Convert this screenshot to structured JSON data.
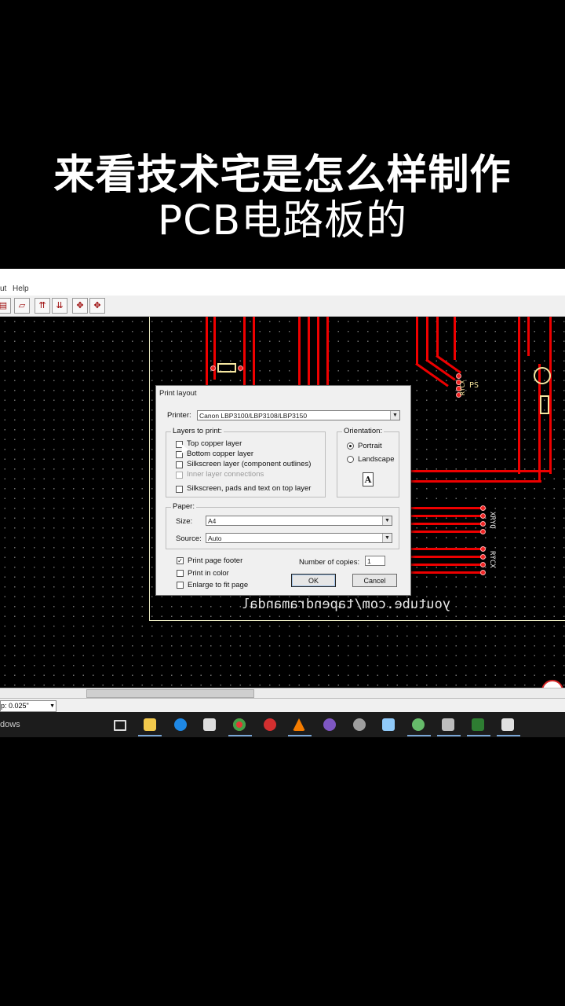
{
  "caption": {
    "line1": "来看技术宅是怎么样制作",
    "line2": "PCB电路板的"
  },
  "menubar": {
    "items": [
      "ut",
      "Help"
    ]
  },
  "canvas": {
    "labels": {
      "ps": "PS",
      "rycx_top": "RYCX",
      "xryq": "XRYQ",
      "rycx_bottom": "RYCX",
      "watermark": "youtube.com/tapendramandal"
    }
  },
  "status": {
    "grid": "p: 0.025\""
  },
  "taskbar": {
    "start_text": "dows"
  },
  "dialog": {
    "title": "Print layout",
    "printer_label": "Printer:",
    "printer_value": "Canon LBP3100/LBP3108/LBP3150",
    "layers_label": "Layers to print:",
    "layers": [
      {
        "label": "Top copper layer",
        "checked": false,
        "enabled": true
      },
      {
        "label": "Bottom copper layer",
        "checked": false,
        "enabled": true
      },
      {
        "label": "Silkscreen layer (component outlines)",
        "checked": false,
        "enabled": true
      },
      {
        "label": "Inner layer connections",
        "checked": false,
        "enabled": false
      },
      {
        "label": "Silkscreen, pads and text on top layer",
        "checked": false,
        "enabled": true
      }
    ],
    "orientation_label": "Orientation:",
    "portrait_label": "Portrait",
    "landscape_label": "Landscape",
    "orientation_selected": "Portrait",
    "orientation_icon_letter": "A",
    "paper_label": "Paper:",
    "size_label": "Size:",
    "size_value": "A4",
    "source_label": "Source:",
    "source_value": "Auto",
    "footer_label": "Print page footer",
    "footer_checked": true,
    "color_label": "Print in color",
    "color_checked": false,
    "enlarge_label": "Enlarge to fit page",
    "enlarge_checked": false,
    "copies_label": "Number of copies:",
    "copies_value": "1",
    "ok_label": "OK",
    "cancel_label": "Cancel"
  }
}
